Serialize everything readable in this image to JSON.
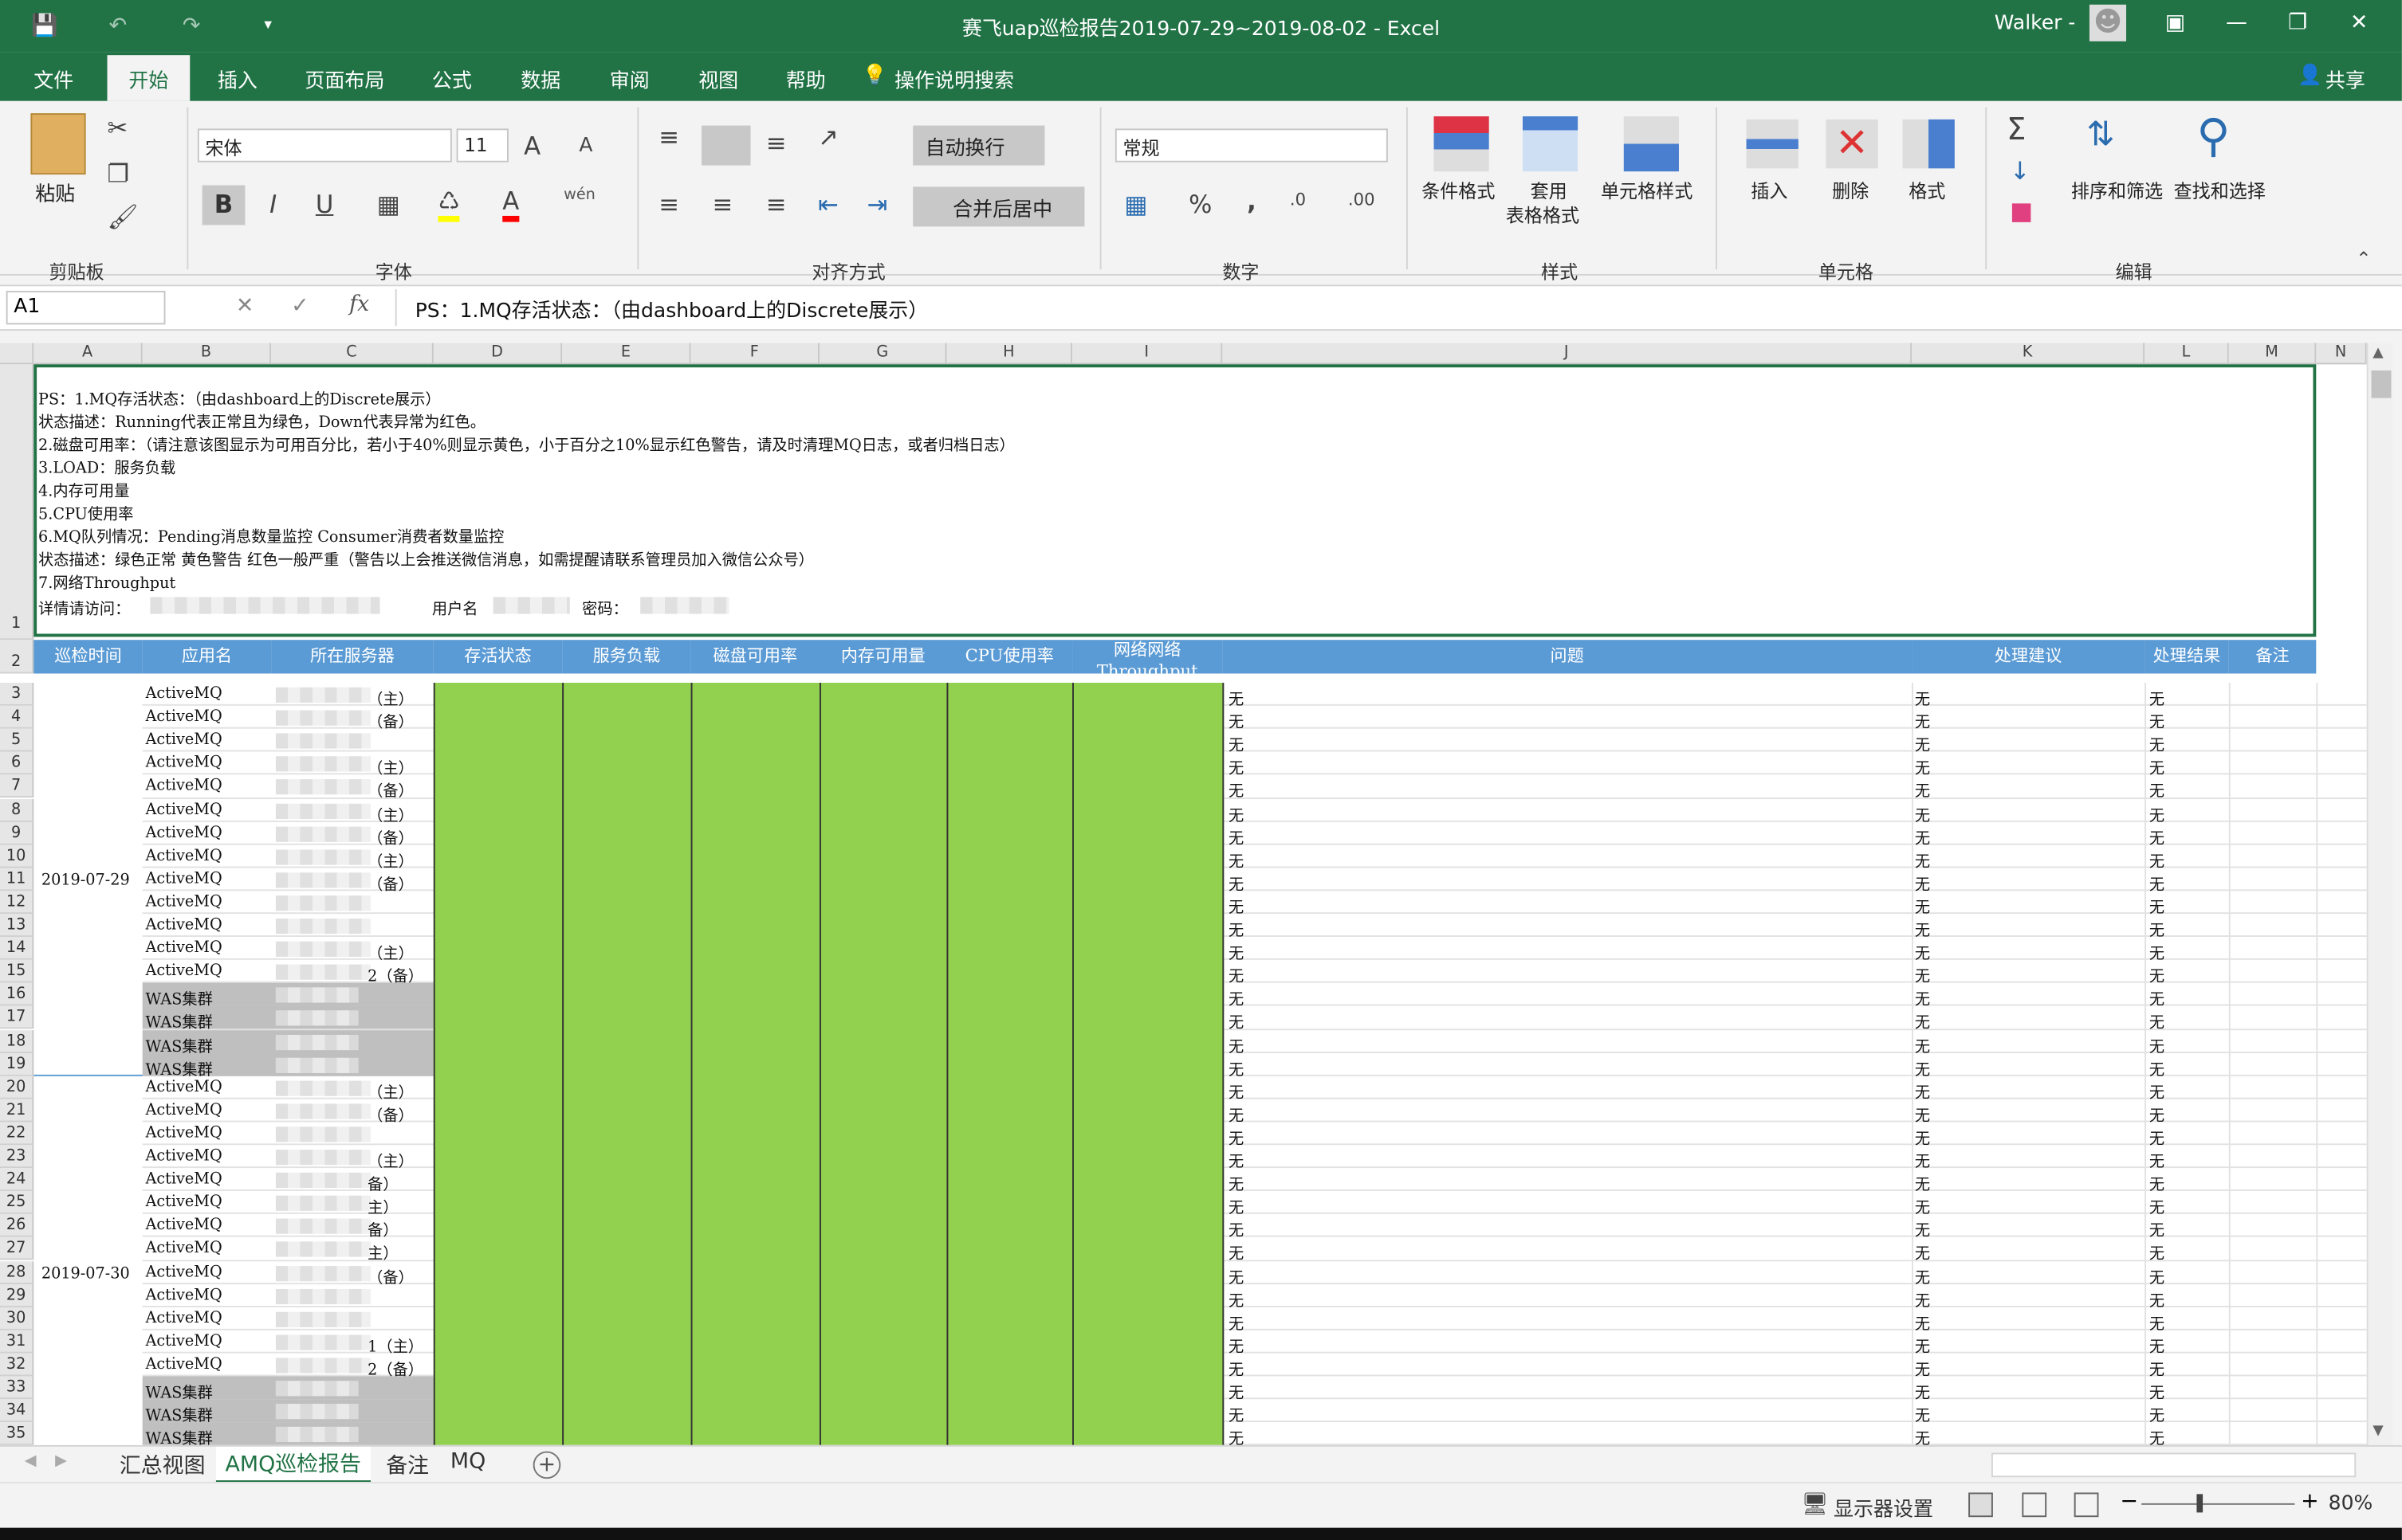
{
  "window": {
    "title": "赛飞uap巡检报告2019-07-29~2019-08-02  -  Excel",
    "user": "Walker -"
  },
  "menu_tabs": [
    "文件",
    "开始",
    "插入",
    "页面布局",
    "公式",
    "数据",
    "审阅",
    "视图",
    "帮助"
  ],
  "tell_me": "操作说明搜索",
  "share": "共享",
  "ribbon": {
    "paste": "粘贴",
    "clipboard": "剪贴板",
    "font_name": "宋体",
    "font_size": "11",
    "font_group": "字体",
    "wrap_text": "自动换行",
    "merge_center": "合并后居中",
    "align_group": "对齐方式",
    "number_format": "常规",
    "number_group": "数字",
    "cond_format": "条件格式",
    "table_format_1": "套用",
    "table_format_2": "表格格式",
    "cell_styles": "单元格样式",
    "styles_group": "样式",
    "insert": "插入",
    "delete": "删除",
    "format": "格式",
    "cells_group": "单元格",
    "sort_filter": "排序和筛选",
    "find_select": "查找和选择",
    "edit_group": "编辑",
    "phonetic": "wén"
  },
  "formula": {
    "name_box": "A1",
    "content": "PS：1.MQ存活状态：（由dashboard上的Discrete展示）"
  },
  "columns": [
    "A",
    "B",
    "C",
    "D",
    "E",
    "F",
    "G",
    "H",
    "I",
    "J",
    "K",
    "L",
    "M",
    "N"
  ],
  "note_lines": [
    "PS：1.MQ存活状态：（由dashboard上的Discrete展示）",
    "      状态描述：Running代表正常且为绿色，Down代表异常为红色。",
    "    2.磁盘可用率：（请注意该图显示为可用百分比，若小于40%则显示黄色，小于百分之10%显示红色警告，请及时清理MQ日志，或者归档日志）",
    "    3.LOAD：服务负载",
    "    4.内存可用量",
    "    5.CPU使用率",
    "    6.MQ队列情况：Pending消息数量监控  Consumer消费者数量监控",
    "      状态描述：绿色正常    黄色警告    红色一般严重（警告以上会推送微信消息，如需提醒请联系管理员加入微信公众号）",
    "    7.网络Throughput"
  ],
  "note_access": {
    "visit": "详情请访问：",
    "user": "用户名",
    "pwd": "密码："
  },
  "headers": {
    "a": "巡检时间",
    "b": "应用名",
    "c": "所在服务器",
    "d": "存活状态",
    "e": "服务负载",
    "f": "磁盘可用率",
    "g": "内存可用量",
    "h": "CPU使用率",
    "i1": "网络网络",
    "i2": "Throughput",
    "j": "问题",
    "k": "处理建议",
    "l": "处理结果",
    "m": "备注"
  },
  "dates": {
    "d1": "2019-07-29",
    "d2": "2019-07-30"
  },
  "rows": [
    {
      "n": "3",
      "app": "ActiveMQ",
      "srv": "（主）",
      "gray": false
    },
    {
      "n": "4",
      "app": "ActiveMQ",
      "srv": "（备）",
      "gray": false
    },
    {
      "n": "5",
      "app": "ActiveMQ",
      "srv": "",
      "gray": false
    },
    {
      "n": "6",
      "app": "ActiveMQ",
      "srv": "（主）",
      "gray": false
    },
    {
      "n": "7",
      "app": "ActiveMQ",
      "srv": "（备）",
      "gray": false
    },
    {
      "n": "8",
      "app": "ActiveMQ",
      "srv": "（主）",
      "gray": false
    },
    {
      "n": "9",
      "app": "ActiveMQ",
      "srv": "（备）",
      "gray": false
    },
    {
      "n": "10",
      "app": "ActiveMQ",
      "srv": "（主）",
      "gray": false
    },
    {
      "n": "11",
      "app": "ActiveMQ",
      "srv": "（备）",
      "gray": false
    },
    {
      "n": "12",
      "app": "ActiveMQ",
      "srv": "",
      "gray": false
    },
    {
      "n": "13",
      "app": "ActiveMQ",
      "srv": "",
      "gray": false
    },
    {
      "n": "14",
      "app": "ActiveMQ",
      "srv": "（主）",
      "gray": false
    },
    {
      "n": "15",
      "app": "ActiveMQ",
      "srv": "2（备）",
      "gray": false
    },
    {
      "n": "16",
      "app": "WAS集群",
      "srv": "",
      "gray": true
    },
    {
      "n": "17",
      "app": "WAS集群",
      "srv": "",
      "gray": true
    },
    {
      "n": "18",
      "app": "WAS集群",
      "srv": "",
      "gray": true
    },
    {
      "n": "19",
      "app": "WAS集群",
      "srv": "",
      "gray": true
    },
    {
      "n": "20",
      "app": "ActiveMQ",
      "srv": "（主）",
      "gray": false
    },
    {
      "n": "21",
      "app": "ActiveMQ",
      "srv": "（备）",
      "gray": false
    },
    {
      "n": "22",
      "app": "ActiveMQ",
      "srv": "",
      "gray": false
    },
    {
      "n": "23",
      "app": "ActiveMQ",
      "srv": "（主）",
      "gray": false
    },
    {
      "n": "24",
      "app": "ActiveMQ",
      "srv": "备）",
      "gray": false
    },
    {
      "n": "25",
      "app": "ActiveMQ",
      "srv": "主）",
      "gray": false
    },
    {
      "n": "26",
      "app": "ActiveMQ",
      "srv": "备）",
      "gray": false
    },
    {
      "n": "27",
      "app": "ActiveMQ",
      "srv": "主）",
      "gray": false
    },
    {
      "n": "28",
      "app": "ActiveMQ",
      "srv": "（备）",
      "gray": false
    },
    {
      "n": "29",
      "app": "ActiveMQ",
      "srv": "",
      "gray": false
    },
    {
      "n": "30",
      "app": "ActiveMQ",
      "srv": "",
      "gray": false
    },
    {
      "n": "31",
      "app": "ActiveMQ",
      "srv": "1（主）",
      "gray": false
    },
    {
      "n": "32",
      "app": "ActiveMQ",
      "srv": "2（备）",
      "gray": false
    },
    {
      "n": "33",
      "app": "WAS集群",
      "srv": "",
      "gray": true
    },
    {
      "n": "34",
      "app": "WAS集群",
      "srv": "",
      "gray": true
    },
    {
      "n": "35",
      "app": "WAS集群",
      "srv": "",
      "gray": true
    }
  ],
  "none": "无",
  "sheets": [
    "汇总视图",
    "AMQ巡检报告",
    "备注",
    "MQ"
  ],
  "status": {
    "display": "显示器设置",
    "zoom": "80%"
  }
}
